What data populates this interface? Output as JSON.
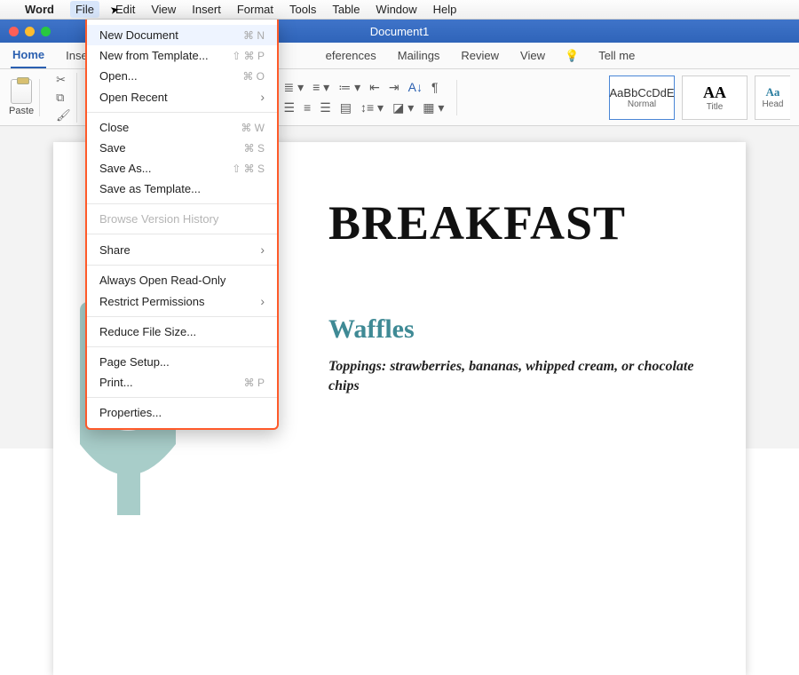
{
  "menubar": {
    "items": [
      "Word",
      "File",
      "Edit",
      "View",
      "Insert",
      "Format",
      "Tools",
      "Table",
      "Window",
      "Help"
    ],
    "open_index": 1
  },
  "titlebar": {
    "title": "Document1"
  },
  "ribbon_tabs": {
    "items": [
      "Home",
      "Insert",
      "",
      "eferences",
      "Mailings",
      "Review",
      "View"
    ],
    "tell_me": "Tell me",
    "active_index": 0
  },
  "ribbon": {
    "paste_label": "Paste",
    "font_size_value": "",
    "icons": {
      "clear_format": "A",
      "pilcrow": "¶"
    }
  },
  "styles": [
    {
      "sample": "AaBbCcDdE",
      "label": "Normal",
      "selected": true,
      "variant": "normal"
    },
    {
      "sample": "AA",
      "label": "Title",
      "selected": false,
      "variant": "big"
    },
    {
      "sample": "Aa",
      "label": "Head",
      "selected": false,
      "variant": "blue"
    }
  ],
  "file_menu": [
    {
      "label": "New Document",
      "shortcut": "⌘ N"
    },
    {
      "label": "New from Template...",
      "shortcut": "⇧ ⌘ P"
    },
    {
      "label": "Open...",
      "shortcut": "⌘ O"
    },
    {
      "label": "Open Recent",
      "submenu": true
    },
    {
      "sep": true
    },
    {
      "label": "Close",
      "shortcut": "⌘ W"
    },
    {
      "label": "Save",
      "shortcut": "⌘ S"
    },
    {
      "label": "Save As...",
      "shortcut": "⇧ ⌘ S"
    },
    {
      "label": "Save as Template..."
    },
    {
      "sep": true
    },
    {
      "label": "Browse Version History",
      "disabled": true
    },
    {
      "sep": true
    },
    {
      "label": "Share",
      "submenu": true
    },
    {
      "sep": true
    },
    {
      "label": "Always Open Read-Only"
    },
    {
      "label": "Restrict Permissions",
      "submenu": true
    },
    {
      "sep": true
    },
    {
      "label": "Reduce File Size..."
    },
    {
      "sep": true
    },
    {
      "label": "Page Setup..."
    },
    {
      "label": "Print...",
      "shortcut": "⌘ P"
    },
    {
      "sep": true
    },
    {
      "label": "Properties..."
    }
  ],
  "document": {
    "heading": "BREAKFAST",
    "subheading": "Waffles",
    "toppings": "Toppings: strawberries, bananas, whipped cream, or chocolate chips"
  },
  "colors": {
    "accent": "#2a5fb0",
    "menu_highlight": "#ff5a2a",
    "teal": "#3f8a95",
    "fork": "#a8cdc9"
  }
}
